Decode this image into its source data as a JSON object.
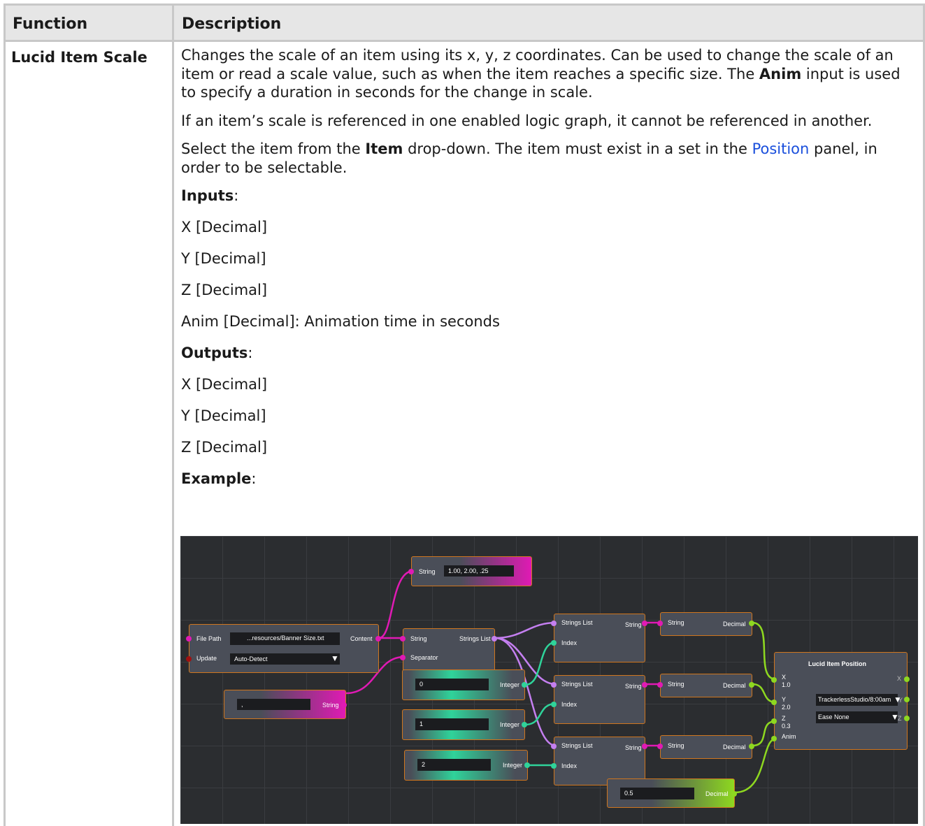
{
  "table": {
    "header_function": "Function",
    "header_description": "Description"
  },
  "row": {
    "function": "Lucid Item Scale",
    "para1_a": "Changes the scale of an item using its x, y, z coordinates. Can be used to change the scale of an item or read a scale value, such as when the item reaches a specific size. The ",
    "para1_bold": "Anim",
    "para1_b": " input is used to specify a duration in seconds for the change in scale.",
    "para2": "If an item’s scale is referenced in one enabled logic graph, it cannot be referenced in another.",
    "para3_a": "Select the item from the ",
    "para3_bold": "Item",
    "para3_b": " drop-down. The item must exist in a set in the ",
    "para3_link": "Position",
    "para3_c": " panel, in order to be selectable.",
    "inputs_label": "Inputs",
    "inputs": [
      "X [Decimal]",
      "Y [Decimal]",
      "Z [Decimal]",
      "Anim [Decimal]: Animation time in seconds"
    ],
    "outputs_label": "Outputs",
    "outputs": [
      "X [Decimal]",
      "Y [Decimal]",
      "Z [Decimal]"
    ],
    "example_label": "Example",
    "colon": ":"
  },
  "graph": {
    "string_top": {
      "label": "String",
      "value": "1.00, 2.00, .25"
    },
    "file_node": {
      "file_path": "File Path",
      "path_value": "...resources/Banner Size.txt",
      "content": "Content",
      "update": "Update",
      "update_value": "Auto-Detect"
    },
    "sep_string": {
      "value": ",",
      "label": "String"
    },
    "split_node": {
      "string": "String",
      "strings_list": "Strings List",
      "separator": "Separator"
    },
    "ints": [
      {
        "value": "0",
        "label": "Integer"
      },
      {
        "value": "1",
        "label": "Integer"
      },
      {
        "value": "2",
        "label": "Integer"
      }
    ],
    "list_nodes": [
      {
        "strings_list": "Strings List",
        "string": "String",
        "index": "Index"
      },
      {
        "strings_list": "Strings List",
        "string": "String",
        "index": "Index"
      },
      {
        "strings_list": "Strings List",
        "string": "String",
        "index": "Index"
      }
    ],
    "convert_nodes": [
      {
        "string": "String",
        "decimal": "Decimal"
      },
      {
        "string": "String",
        "decimal": "Decimal"
      },
      {
        "string": "String",
        "decimal": "Decimal"
      }
    ],
    "decimal_in": {
      "value": "0.5",
      "label": "Decimal"
    },
    "lucid": {
      "title": "Lucid Item Position",
      "x": "X",
      "x_val": "1.0",
      "y": "Y",
      "y_val": "2.0",
      "z": "Z",
      "z_val": "0.3",
      "anim": "Anim",
      "item_value": "TrackerlessStudio/8:00am",
      "ease_value": "Ease None",
      "out_x": "X",
      "out_y": "Y",
      "out_z": "Z"
    },
    "colors": {
      "string": "#e01ab4",
      "list": "#c47ff0",
      "integer": "#2fd39a",
      "decimal": "#8ed820",
      "border": "#d0761e"
    }
  }
}
